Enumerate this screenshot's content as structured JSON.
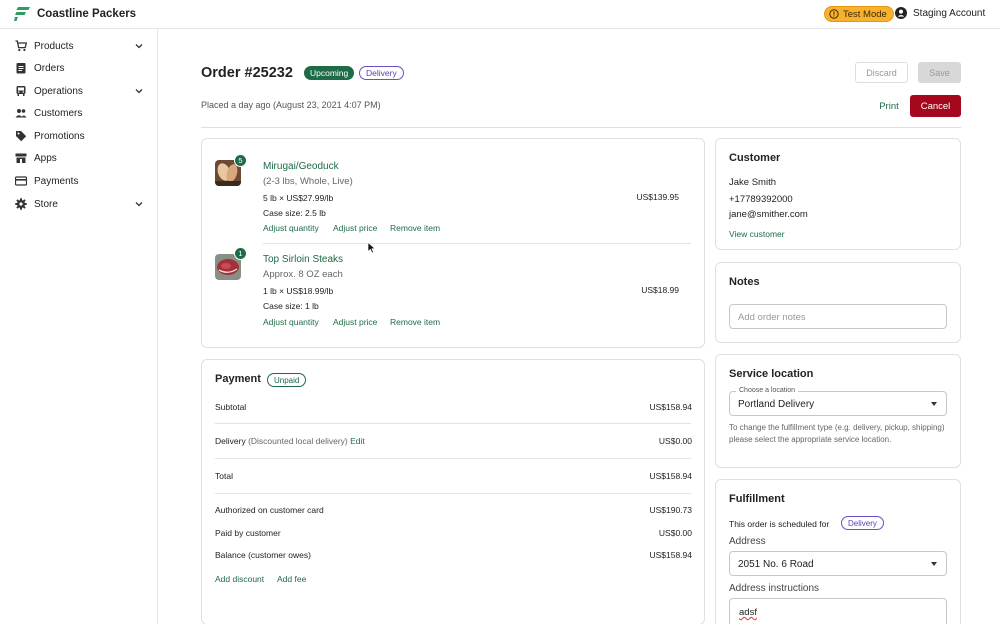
{
  "app": {
    "brand": "Coastline Packers",
    "test_mode": "Test Mode",
    "account": "Staging Account",
    "colors": {
      "primary": "#1e6b47",
      "danger": "#a5081d",
      "warning": "#f7b12e",
      "delivery": "#5b3fb3"
    }
  },
  "sidebar": {
    "items": [
      {
        "label": "Products",
        "icon": "cart-icon",
        "expandable": true
      },
      {
        "label": "Orders",
        "icon": "clipboard-icon",
        "expandable": false
      },
      {
        "label": "Operations",
        "icon": "truck-icon",
        "expandable": true
      },
      {
        "label": "Customers",
        "icon": "people-icon",
        "expandable": false
      },
      {
        "label": "Promotions",
        "icon": "tag-icon",
        "expandable": false
      },
      {
        "label": "Apps",
        "icon": "store-icon",
        "expandable": false
      },
      {
        "label": "Payments",
        "icon": "card-icon",
        "expandable": false
      },
      {
        "label": "Store",
        "icon": "gear-icon",
        "expandable": true
      }
    ]
  },
  "order": {
    "title": "Order #25232",
    "status_badge": "Upcoming",
    "type_badge": "Delivery",
    "placed": "Placed a day ago (August 23, 2021 4:07 PM)",
    "buttons": {
      "discard": "Discard",
      "save": "Save",
      "print": "Print",
      "cancel": "Cancel"
    }
  },
  "items": [
    {
      "qty": "5",
      "name": "Mirugai/Geoduck",
      "variant": "(2-3 lbs, Whole, Live)",
      "price_line": "5 lb × US$27.99/lb",
      "case_size": "Case size: 2.5 lb",
      "total": "US$139.95",
      "actions": [
        "Adjust quantity",
        "Adjust price",
        "Remove item"
      ]
    },
    {
      "qty": "1",
      "name": "Top Sirloin Steaks",
      "variant": "Approx. 8 OZ each",
      "price_line": "1 lb × US$18.99/lb",
      "case_size": "Case size: 1 lb",
      "total": "US$18.99",
      "actions": [
        "Adjust quantity",
        "Adjust price",
        "Remove item"
      ]
    }
  ],
  "payment": {
    "title": "Payment",
    "status": "Unpaid",
    "subtotal_label": "Subtotal",
    "subtotal": "US$158.94",
    "delivery_label": "Delivery",
    "delivery_note": "(Discounted local delivery)",
    "delivery_edit": "Edit",
    "delivery": "US$0.00",
    "total_label": "Total",
    "total": "US$158.94",
    "authorized_label": "Authorized on customer card",
    "authorized": "US$190.73",
    "paid_label": "Paid by customer",
    "paid": "US$0.00",
    "balance_label": "Balance (customer owes)",
    "balance": "US$158.94",
    "add_discount": "Add discount",
    "add_fee": "Add fee"
  },
  "customer": {
    "title": "Customer",
    "name": "Jake Smith",
    "phone": "+17789392000",
    "email": "jane@smither.com",
    "view_link": "View customer"
  },
  "notes": {
    "title": "Notes",
    "placeholder": "Add order notes"
  },
  "service": {
    "title": "Service location",
    "legend": "Choose a location",
    "value": "Portland Delivery",
    "help": "To change the fulfillment type (e.g. delivery, pickup, shipping) please select the appropriate service location."
  },
  "fulfillment": {
    "title": "Fulfillment",
    "scheduled_text": "This order is scheduled for",
    "scheduled_badge": "Delivery",
    "address_label": "Address",
    "address_value": "2051 No. 6 Road",
    "instructions_label": "Address instructions",
    "instructions_value": "adsf"
  }
}
